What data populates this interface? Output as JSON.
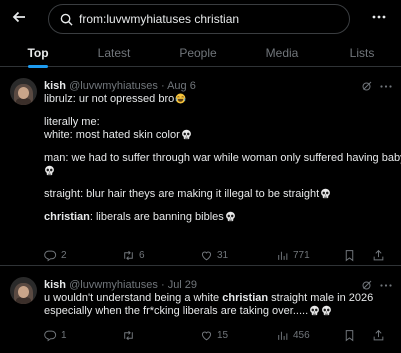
{
  "search": {
    "query": "from:luvwmyhiatuses christian"
  },
  "tabs": [
    {
      "label": "Top"
    },
    {
      "label": "Latest"
    },
    {
      "label": "People"
    },
    {
      "label": "Media"
    },
    {
      "label": "Lists"
    }
  ],
  "icons": {
    "back": "back-arrow-icon",
    "search": "search-icon",
    "more": "more-horizontal-icon",
    "grok": "grok-icon",
    "reply": "reply-icon",
    "retweet": "retweet-icon",
    "like": "like-icon",
    "views": "views-icon",
    "bookmark": "bookmark-icon",
    "share": "share-icon"
  },
  "colors": {
    "accent": "#1d9bf0",
    "text": "#e7e9ea",
    "muted": "#71767b",
    "border": "#2f3336"
  },
  "tweets": [
    {
      "name": "kish",
      "handle": "@luvwmyhiatuses",
      "sep": "·",
      "date": "Aug 6",
      "lines": {
        "l1": "librulz: ur not opressed bro",
        "l2": "literally me:",
        "l3": "white: most hated skin color",
        "l4": "man: we had to suffer through war while woman only suffered having baby",
        "l5": "straight: blur hair theys are making it illegal to be straight",
        "l6a": "christian",
        "l6b": ": liberals are banning bibles"
      },
      "counts": {
        "replies": "2",
        "reposts": "6",
        "likes": "31",
        "views": "771"
      }
    },
    {
      "name": "kish",
      "handle": "@luvwmyhiatuses",
      "sep": "·",
      "date": "Jul 29",
      "lines": {
        "l1a": "u wouldn't understand being a white ",
        "l1b": "christian",
        "l1c": " straight male in 2026",
        "l2": "especially when the fr*cking liberals are taking over....."
      },
      "counts": {
        "replies": "1",
        "reposts": "",
        "likes": "15",
        "views": "456"
      }
    }
  ]
}
